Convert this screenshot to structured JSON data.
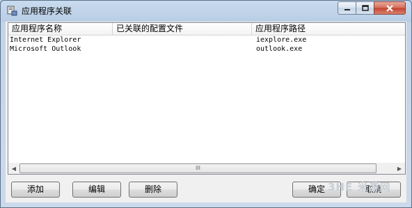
{
  "window": {
    "title": "应用程序关联",
    "icon": "program-association-icon"
  },
  "controls": {
    "minimize": "minimize-icon",
    "maximize": "maximize-icon",
    "close": "close-icon"
  },
  "list": {
    "columns": [
      "应用程序名称",
      "已关联的配置文件",
      "应用程序路径"
    ],
    "rows": [
      {
        "name": "Internet Explorer",
        "profile": "",
        "path": "iexplore.exe"
      },
      {
        "name": "Microsoft Outlook",
        "profile": "",
        "path": "outlook.exe"
      }
    ],
    "scroll_grip": "III"
  },
  "buttons": {
    "add": "添加",
    "edit": "编辑",
    "delete": "删除",
    "ok": "确定",
    "cancel": "取消"
  },
  "watermark": "3HE 米游网"
}
